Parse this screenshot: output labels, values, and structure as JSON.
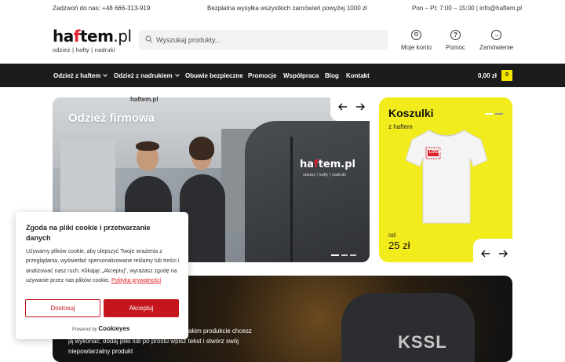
{
  "topbar": {
    "phone": "Zadzwoń do nas: +48 666-313-919",
    "shipping": "Bezpłatna wysyłka wszystkich zamówień powyżej 1000 zł",
    "hours": "Pon – Pt: 7:00 – 15:00 | info@haftem.pl"
  },
  "logo": {
    "brand_a": "ha",
    "brand_mark": "f",
    "brand_b": "tem",
    "brand_c": ".pl",
    "tagline": "odzież | hafty | nadruki"
  },
  "search": {
    "placeholder": "Wyszukaj produkty..."
  },
  "header_links": {
    "account": "Moje konto",
    "help": "Pomoc",
    "order": "Zamówienie"
  },
  "nav": {
    "items": [
      "Odzież z haftem",
      "Odzież z nadrukiem",
      "Obuwie bezpieczne",
      "Promocje",
      "Współpraca",
      "Blog",
      "Kontakt"
    ],
    "cart_total": "0,00 zł",
    "cart_count": "0"
  },
  "hero": {
    "title": "Odzież firmowa",
    "logo_text": "haftem.pl",
    "jacket_logo_a": "ha",
    "jacket_logo_mark": "f",
    "jacket_logo_b": "tem.pl",
    "jacket_tagline": "odzież | hafty | nadruki",
    "active_slide": 1,
    "slide_count": 3
  },
  "promo": {
    "title": "Koszulki",
    "subtitle": "z haftem",
    "logo_badge": "LOGO",
    "from_label": "od",
    "price": "25 zł",
    "slide_count": 2,
    "active_slide": 1
  },
  "banner": {
    "text_lines": [
      "na jakim produkcie chcesz",
      "ją wykonać, dodaj pliki lub po prostu wpisz tekst i stwórz swój",
      "niepowtarzalny produkt"
    ],
    "shirt_print": "KSSL"
  },
  "cookie": {
    "title": "Zgoda na pliki cookie i przetwarzanie danych",
    "body": "Używamy plików cookie, aby ulepszyć Twoje wrażenia z przeglądania, wyświetlać spersonalizowane reklamy lub treści i analizować nasz ruch. Klikając „Akceptuj\", wyrażasz zgodę na używanie przez nas plików cookie. ",
    "policy_link": "Polityka prywatności",
    "decline": "Dostosuj",
    "accept": "Akceptuj",
    "powered": "Powered by",
    "powered_brand": "Cookieyes"
  },
  "colors": {
    "accent_red": "#c4161c",
    "yellow": "#f3ec1c",
    "nav_bg": "#1c1c1c"
  }
}
